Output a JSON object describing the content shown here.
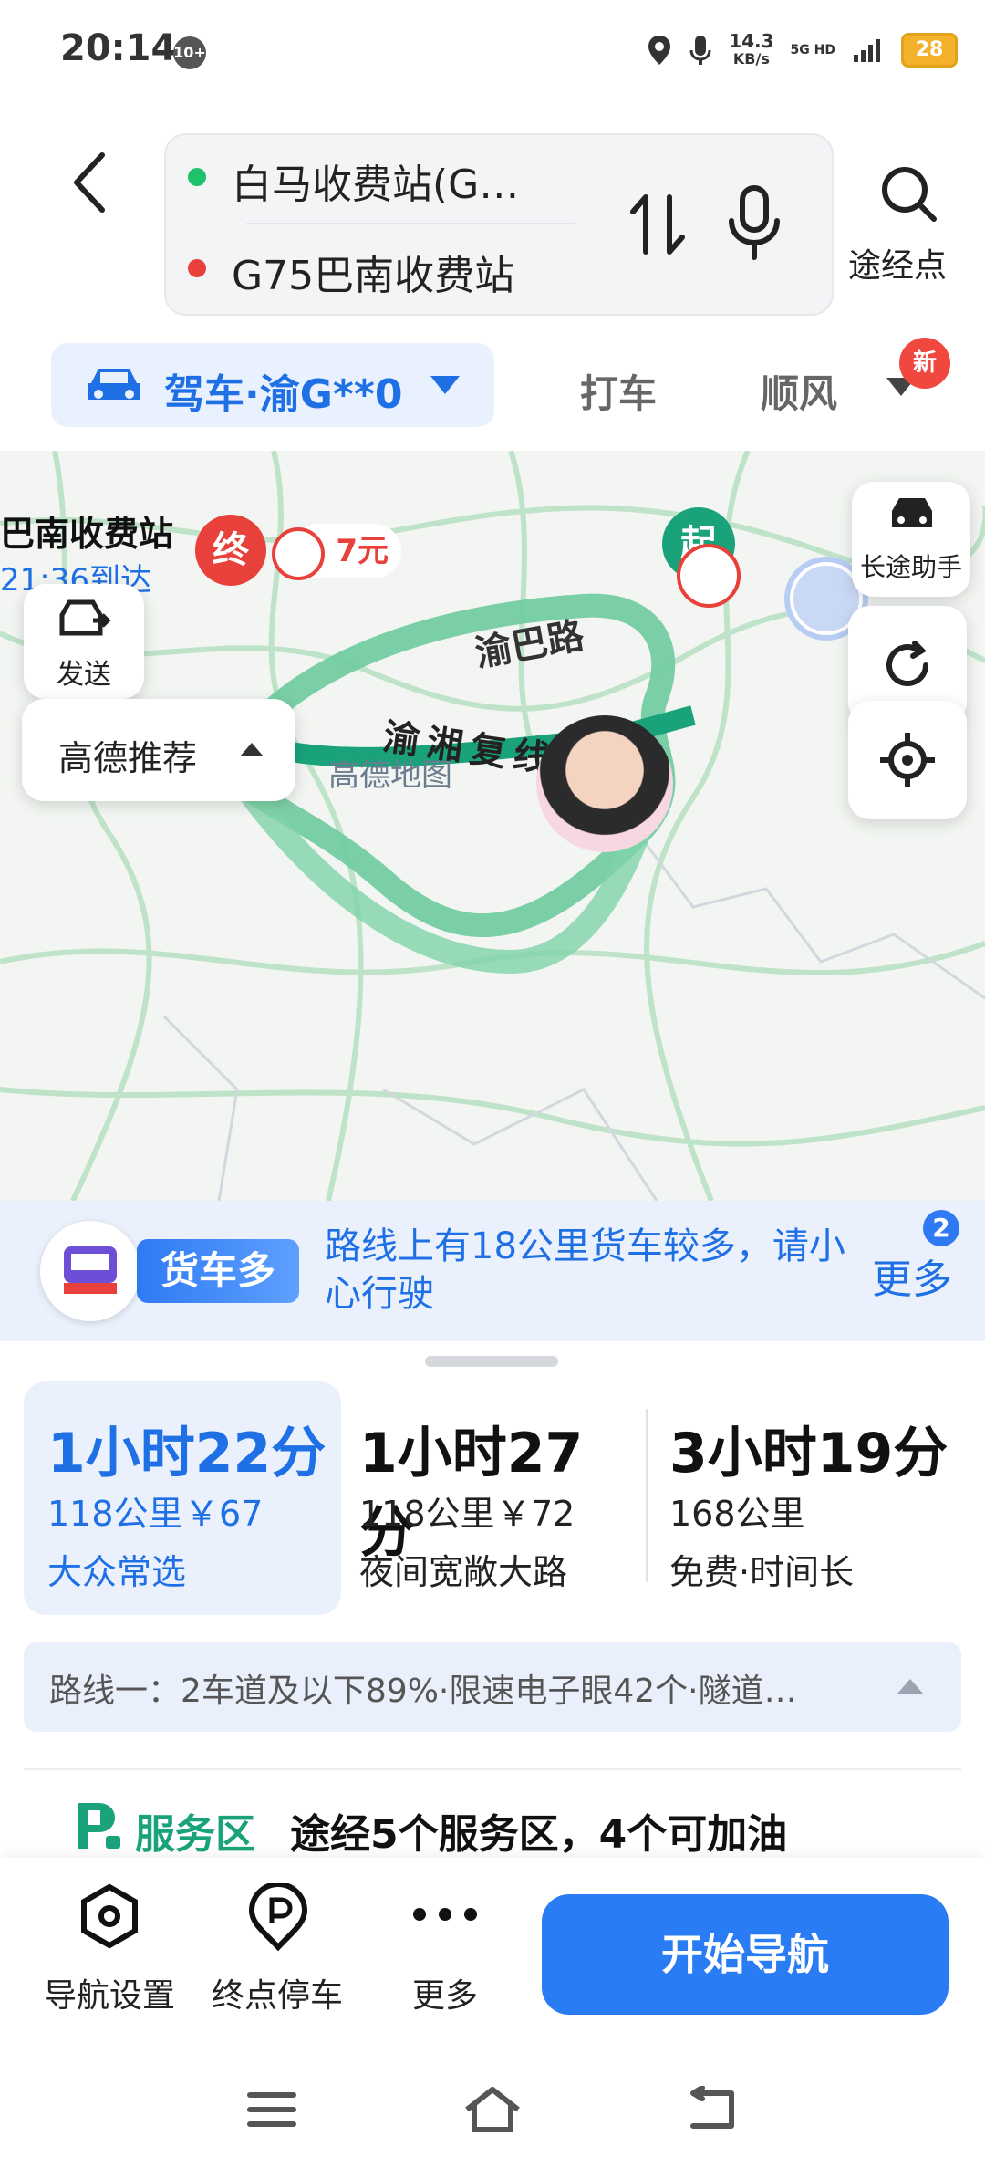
{
  "status_bar": {
    "time": "20:14",
    "badge": "10+",
    "speed_value": "14.3",
    "speed_unit": "KB/s",
    "network": "5G HD",
    "battery": "28"
  },
  "header": {
    "origin": "白马收费站(G…",
    "destination": "G75巴南收费站",
    "waypoint_label": "途经点"
  },
  "mode_tabs": {
    "drive": "驾车·渝G**0",
    "taxi": "打车",
    "ride": "顺风",
    "new_badge": "新"
  },
  "map": {
    "road_yuba": "渝巴路",
    "road_yuxiang": "渝湘复线",
    "dest_name": "巴南收费站",
    "arrive_time": "21:36到达",
    "end_marker": "终",
    "start_marker": "起",
    "toll_price": "7元",
    "long_trip_helper": "长途助手",
    "send_label": "发送",
    "recommend_label": "高德推荐",
    "watermark": "高德地图"
  },
  "truck_banner": {
    "label": "货车多",
    "message": "路线上有18公里货车较多，请小心行驶",
    "more": "更多",
    "count": "2"
  },
  "routes": [
    {
      "time": "1小时22分",
      "distance": "118公里",
      "price": "￥67",
      "tag": "大众常选",
      "selected": true
    },
    {
      "time": "1小时27分",
      "distance": "118公里",
      "price": "￥72",
      "tag": "夜间宽敞大路",
      "selected": false
    },
    {
      "time": "3小时19分",
      "distance": "168公里",
      "price": "",
      "tag": "免费·时间长",
      "selected": false
    }
  ],
  "route_info": "路线一：2车道及以下89%·限速电子眼42个·隧道…",
  "service_area": {
    "title": "服务区",
    "desc": "途经5个服务区，4个可加油"
  },
  "actions": {
    "nav_settings": "导航设置",
    "parking": "终点停车",
    "more": "更多",
    "start_nav": "开始导航"
  },
  "colors": {
    "accent": "#2a7cf5",
    "route_green": "#1aa37a",
    "end_red": "#e8403a"
  }
}
